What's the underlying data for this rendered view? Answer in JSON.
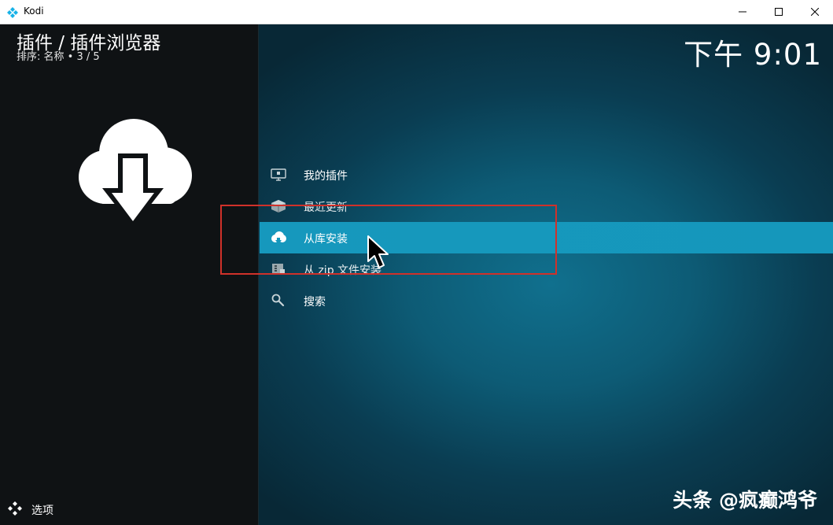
{
  "window": {
    "app_title": "Kodi",
    "app_icon": "kodi-logo-icon",
    "controls": [
      "minimize-icon",
      "maximize-icon",
      "close-icon"
    ]
  },
  "header": {
    "title": "插件 / 插件浏览器",
    "sort_info": "排序: 名称  •  3 / 5",
    "clock": "下午 9:01"
  },
  "preview": {
    "icon": "cloud-download-icon"
  },
  "menu": {
    "selected_index": 2,
    "items": [
      {
        "label": "我的插件",
        "icon": "monitor-addons-icon"
      },
      {
        "label": "最近更新",
        "icon": "box-updates-icon"
      },
      {
        "label": "从库安装",
        "icon": "cloud-install-icon"
      },
      {
        "label": "从 zip 文件安装",
        "icon": "zip-install-icon"
      },
      {
        "label": "搜索",
        "icon": "search-icon"
      }
    ]
  },
  "footer": {
    "options_label": "选项",
    "options_icon": "kodi-options-icon"
  },
  "watermark": {
    "text": "头条 @疯癫鸿爷"
  },
  "colors": {
    "selected_bg": "#1698bd",
    "left_panel_bg": "#0f1214",
    "highlight_box": "#d0312a",
    "background_center": "#10708e",
    "background_edge": "#082836"
  }
}
